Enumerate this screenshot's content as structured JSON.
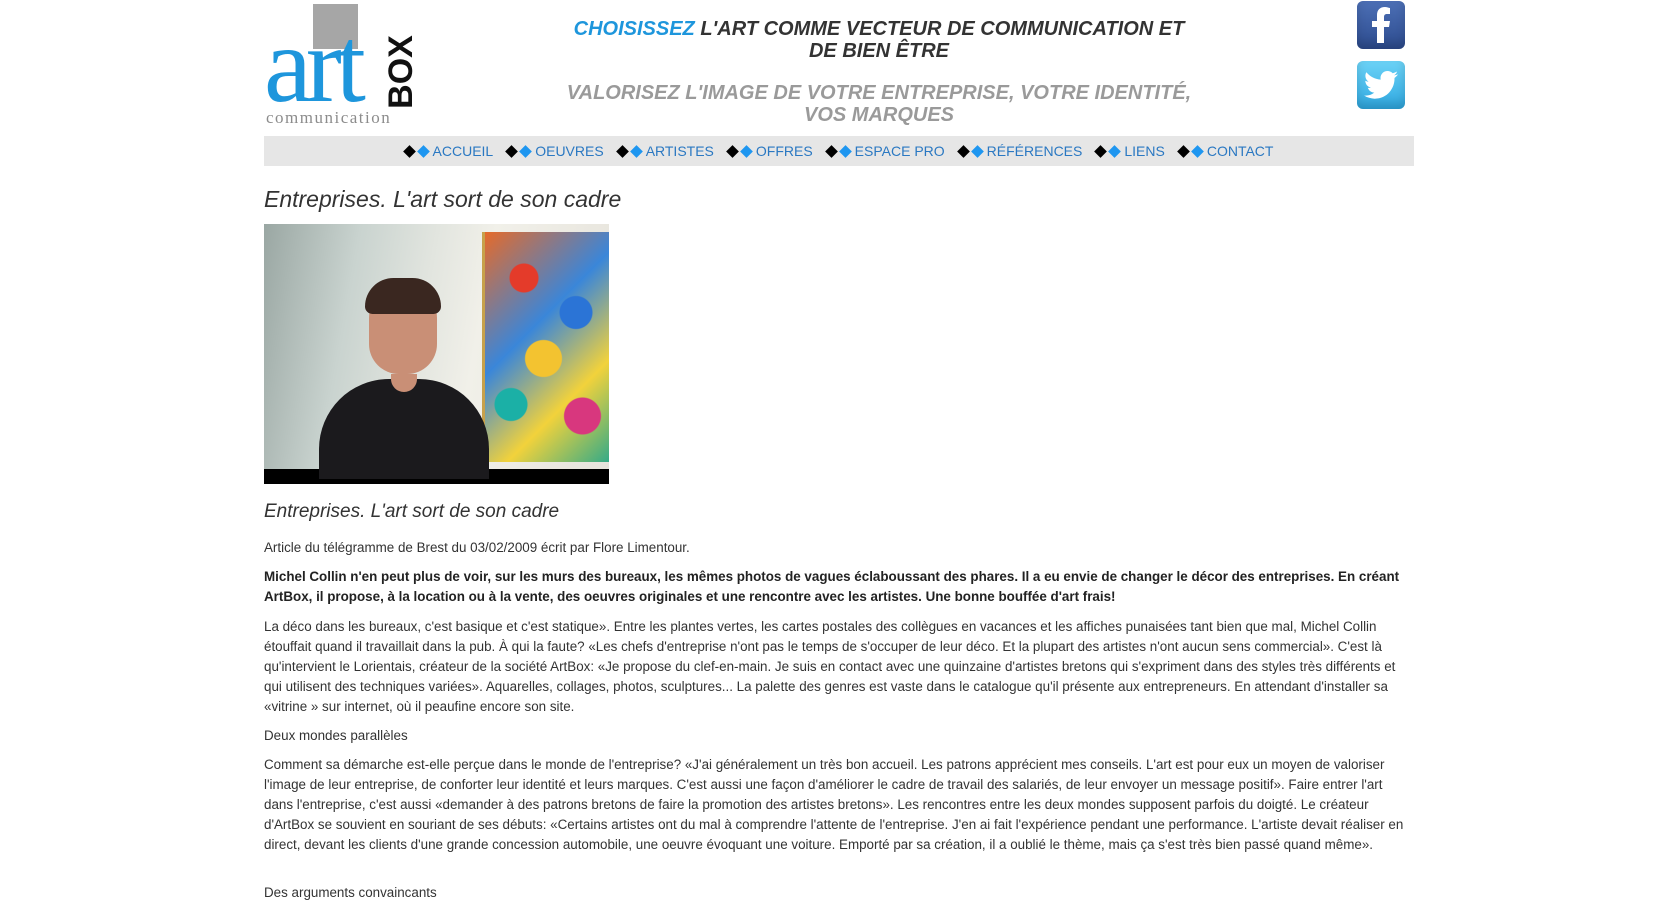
{
  "header": {
    "logo": {
      "art": "art",
      "box": "BOX",
      "communication": "communication"
    },
    "tagline_highlight": "CHOISISSEZ",
    "tagline_rest": " L'ART COMME VECTEUR DE COMMUNICATION ET DE BIEN ÊTRE",
    "subtagline": "VALORISEZ L'IMAGE DE VOTRE ENTREPRISE, VOTRE IDENTITÉ, VOS MARQUES",
    "social": [
      {
        "icon": "facebook-icon",
        "color": "#3b5998"
      },
      {
        "icon": "twitter-icon",
        "color": "#55acee"
      }
    ]
  },
  "nav": {
    "items": [
      {
        "label": "ACCUEIL"
      },
      {
        "label": "OEUVRES"
      },
      {
        "label": "ARTISTES"
      },
      {
        "label": "OFFRES"
      },
      {
        "label": "ESPACE PRO"
      },
      {
        "label": "RÉFÉRENCES"
      },
      {
        "label": "LIENS"
      },
      {
        "label": "CONTACT"
      }
    ]
  },
  "article": {
    "title": "Entreprises. L'art sort de son cadre",
    "subtitle": "Entreprises. L'art sort de son cadre",
    "byline": "Article du télégramme de Brest du 03/02/2009 écrit par Flore Limentour.",
    "lead": "Michel Collin n'en peut plus de voir, sur les murs des bureaux, les mêmes photos de vagues éclaboussant des phares. Il a eu envie de changer le décor des entreprises. En créant ArtBox, il propose, à la location ou à la vente, des oeuvres originales et une rencontre avec les artistes. Une bonne bouffée d'art frais!",
    "p1": "La déco dans les bureaux, c'est basique et c'est statique». Entre les plantes vertes, les cartes postales des collègues en vacances et les affiches punaisées tant bien que mal, Michel Collin étouffait quand il travaillait dans la pub. À qui la faute? «Les chefs d'entreprise n'ont pas le temps de s'occuper de leur déco. Et la plupart des artistes n'ont aucun sens commercial». C'est là qu'intervient le Lorientais, créateur de la société ArtBox: «Je propose du clef-en-main. Je suis en contact avec une quinzaine d'artistes bretons qui s'expriment dans des styles très différents et qui utilisent des techniques variées». Aquarelles, collages, photos, sculptures... La palette des genres est vaste dans le catalogue qu'il présente aux entrepreneurs. En attendant d'installer sa «vitrine » sur internet, où il peaufine encore son site.",
    "section1": "Deux mondes parallèles",
    "p2": "Comment sa démarche est-elle perçue dans le monde de l'entreprise? «J'ai généralement un très bon accueil. Les patrons apprécient mes conseils. L'art est pour eux un moyen de valoriser l'image de leur entreprise, de conforter leur identité et leurs marques. C'est aussi une façon d'améliorer le cadre de travail des salariés, de leur envoyer un message positif». Faire entrer l'art dans l'entreprise, c'est aussi «demander à des patrons bretons de faire la promotion des artistes bretons». Les rencontres entre les deux mondes supposent parfois du doigté. Le créateur d'ArtBox se souvient en souriant de ses débuts: «Certains artistes ont du mal à comprendre l'attente de l'entreprise. J'en ai fait l'expérience pendant une performance. L'artiste devait réaliser en direct, devant les clients d'une grande concession automobile, une oeuvre évoquant une voiture. Emporté par sa création, il a oublié le thème, mais ça s'est très bien passé quand même».",
    "section2": "Des arguments convaincants"
  },
  "colors": {
    "accent_blue": "#1e96dc",
    "nav_link": "#2a78c2",
    "nav_bg": "#e6e6e6",
    "logo_gray": "#a6a6a6"
  }
}
